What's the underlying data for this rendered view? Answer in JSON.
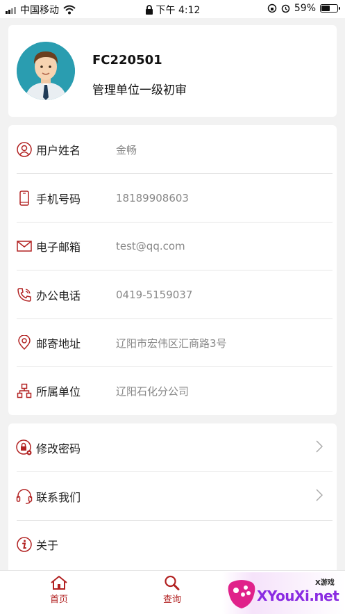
{
  "status_bar": {
    "carrier": "中国移动",
    "time": "下午 4:12",
    "battery_percent": "59%",
    "battery_level": 0.59
  },
  "profile": {
    "user_id": "FC220501",
    "role": "管理单位一级初审"
  },
  "info": {
    "rows": [
      {
        "icon": "user-icon",
        "label": "用户姓名",
        "value": "金畅"
      },
      {
        "icon": "phone-icon",
        "label": "手机号码",
        "value": "18189908603"
      },
      {
        "icon": "mail-icon",
        "label": "电子邮箱",
        "value": "test@qq.com"
      },
      {
        "icon": "telephone-icon",
        "label": "办公电话",
        "value": "0419-5159037"
      },
      {
        "icon": "location-pin-icon",
        "label": "邮寄地址",
        "value": "辽阳市宏伟区汇商路3号"
      },
      {
        "icon": "org-chart-icon",
        "label": "所属单位",
        "value": "辽阳石化分公司"
      }
    ]
  },
  "menu": {
    "items": [
      {
        "icon": "lock-gear-icon",
        "label": "修改密码"
      },
      {
        "icon": "headset-icon",
        "label": "联系我们"
      },
      {
        "icon": "info-icon",
        "label": "关于"
      }
    ]
  },
  "tabbar": {
    "tabs": [
      {
        "icon": "home-icon",
        "label": "首页"
      },
      {
        "icon": "search-icon",
        "label": "查询"
      }
    ]
  },
  "watermark": {
    "brand": "XYouXi.net",
    "tag": "X游戏"
  },
  "colors": {
    "accent": "#b22222",
    "background": "#f2f2f2",
    "value_text": "#888888"
  }
}
